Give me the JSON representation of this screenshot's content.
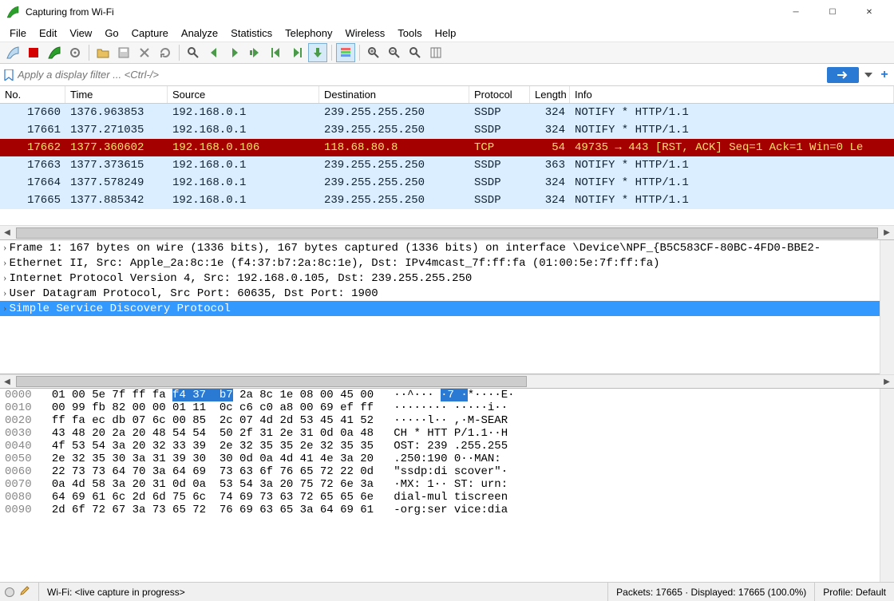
{
  "window": {
    "title": "Capturing from Wi-Fi"
  },
  "menu": [
    "File",
    "Edit",
    "View",
    "Go",
    "Capture",
    "Analyze",
    "Statistics",
    "Telephony",
    "Wireless",
    "Tools",
    "Help"
  ],
  "filter": {
    "placeholder": "Apply a display filter ... <Ctrl-/>"
  },
  "columns": {
    "no": "No.",
    "time": "Time",
    "source": "Source",
    "destination": "Destination",
    "protocol": "Protocol",
    "length": "Length",
    "info": "Info"
  },
  "packets": [
    {
      "no": "17660",
      "time": "1376.963853",
      "src": "192.168.0.1",
      "dst": "239.255.255.250",
      "proto": "SSDP",
      "len": "324",
      "info": "NOTIFY * HTTP/1.1",
      "style": "ssdp"
    },
    {
      "no": "17661",
      "time": "1377.271035",
      "src": "192.168.0.1",
      "dst": "239.255.255.250",
      "proto": "SSDP",
      "len": "324",
      "info": "NOTIFY * HTTP/1.1",
      "style": "ssdp"
    },
    {
      "no": "17662",
      "time": "1377.360602",
      "src": "192.168.0.106",
      "dst": "118.68.80.8",
      "proto": "TCP",
      "len": "54",
      "info": "49735 → 443 [RST, ACK] Seq=1 Ack=1 Win=0 Le",
      "style": "tcp-rst"
    },
    {
      "no": "17663",
      "time": "1377.373615",
      "src": "192.168.0.1",
      "dst": "239.255.255.250",
      "proto": "SSDP",
      "len": "363",
      "info": "NOTIFY * HTTP/1.1",
      "style": "ssdp"
    },
    {
      "no": "17664",
      "time": "1377.578249",
      "src": "192.168.0.1",
      "dst": "239.255.255.250",
      "proto": "SSDP",
      "len": "324",
      "info": "NOTIFY * HTTP/1.1",
      "style": "ssdp"
    },
    {
      "no": "17665",
      "time": "1377.885342",
      "src": "192.168.0.1",
      "dst": "239.255.255.250",
      "proto": "SSDP",
      "len": "324",
      "info": "NOTIFY * HTTP/1.1",
      "style": "ssdp"
    }
  ],
  "details": [
    "Frame 1: 167 bytes on wire (1336 bits), 167 bytes captured (1336 bits) on interface \\Device\\NPF_{B5C583CF-80BC-4FD0-BBE2-",
    "Ethernet II, Src: Apple_2a:8c:1e (f4:37:b7:2a:8c:1e), Dst: IPv4mcast_7f:ff:fa (01:00:5e:7f:ff:fa)",
    "Internet Protocol Version 4, Src: 192.168.0.105, Dst: 239.255.255.250",
    "User Datagram Protocol, Src Port: 60635, Dst Port: 1900",
    "Simple Service Discovery Protocol"
  ],
  "hex": [
    {
      "off": "0000",
      "b1": "01 00 5e 7f ff fa ",
      "hl": "f4 37  b7",
      "b2": " 2a 8c 1e 08 00 45 00",
      "a1": "   ··^··· ",
      "ahl": "·7 ·",
      "a2": "*····E·"
    },
    {
      "off": "0010",
      "b": "00 99 fb 82 00 00 01 11  0c c6 c0 a8 00 69 ef ff",
      "a": "   ········ ·····i··"
    },
    {
      "off": "0020",
      "b": "ff fa ec db 07 6c 00 85  2c 07 4d 2d 53 45 41 52",
      "a": "   ·····l·· ,·M-SEAR"
    },
    {
      "off": "0030",
      "b": "43 48 20 2a 20 48 54 54  50 2f 31 2e 31 0d 0a 48",
      "a": "   CH * HTT P/1.1··H"
    },
    {
      "off": "0040",
      "b": "4f 53 54 3a 20 32 33 39  2e 32 35 35 2e 32 35 35",
      "a": "   OST: 239 .255.255"
    },
    {
      "off": "0050",
      "b": "2e 32 35 30 3a 31 39 30  30 0d 0a 4d 41 4e 3a 20",
      "a": "   .250:190 0··MAN: "
    },
    {
      "off": "0060",
      "b": "22 73 73 64 70 3a 64 69  73 63 6f 76 65 72 22 0d",
      "a": "   \"ssdp:di scover\"·"
    },
    {
      "off": "0070",
      "b": "0a 4d 58 3a 20 31 0d 0a  53 54 3a 20 75 72 6e 3a",
      "a": "   ·MX: 1·· ST: urn:"
    },
    {
      "off": "0080",
      "b": "64 69 61 6c 2d 6d 75 6c  74 69 73 63 72 65 65 6e",
      "a": "   dial-mul tiscreen"
    },
    {
      "off": "0090",
      "b": "2d 6f 72 67 3a 73 65 72  76 69 63 65 3a 64 69 61",
      "a": "   -org:ser vice:dia"
    }
  ],
  "status": {
    "interface": "Wi-Fi: <live capture in progress>",
    "packets": "Packets: 17665 · Displayed: 17665 (100.0%)",
    "profile": "Profile: Default"
  }
}
